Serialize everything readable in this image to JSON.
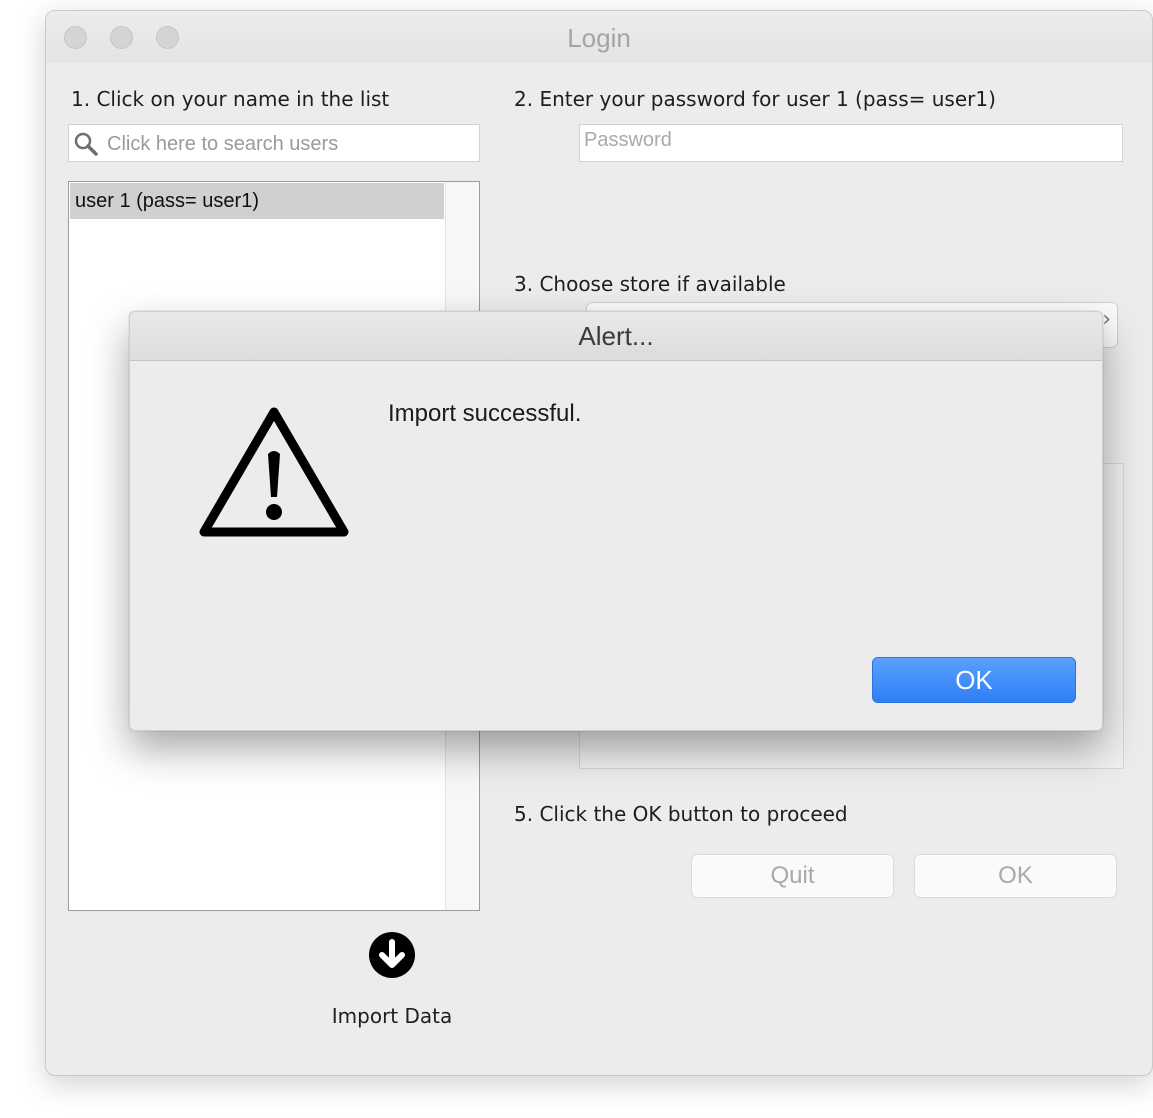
{
  "window": {
    "title": "Login"
  },
  "steps": {
    "step1": "1. Click on your name in the list",
    "step2": "2. Enter your password for user 1 (pass= user1)",
    "step3": "3. Choose store if available",
    "step5": "5. Click the OK button to proceed"
  },
  "search": {
    "placeholder": "Click here to search users",
    "icon": "search-icon"
  },
  "users": [
    {
      "label": "user 1 (pass= user1)",
      "selected": true
    }
  ],
  "password": {
    "placeholder": "Password"
  },
  "buttons": {
    "quit": "Quit",
    "ok": "OK"
  },
  "import": {
    "label": "Import Data",
    "icon": "arrow-down-circle-icon"
  },
  "alert": {
    "title": "Alert...",
    "message": "Import successful.",
    "ok_label": "OK",
    "icon": "warning-triangle-icon"
  },
  "colors": {
    "accent": "#2f7ff5",
    "window_bg": "#ececec"
  }
}
